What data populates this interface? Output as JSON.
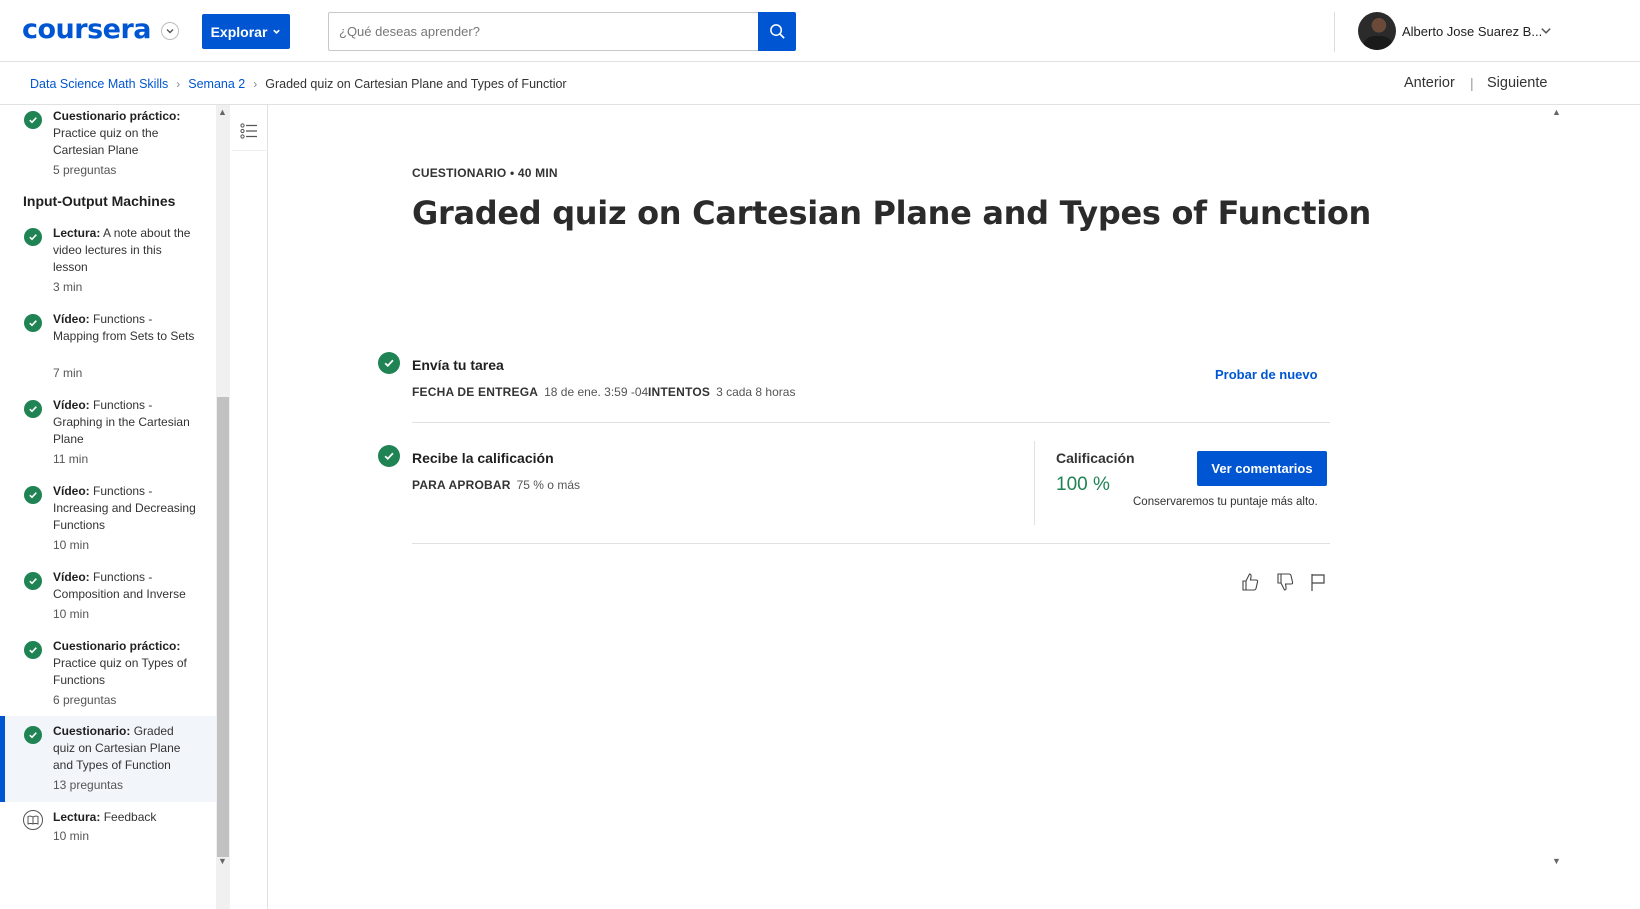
{
  "header": {
    "logo": "coursera",
    "explore_label": "Explorar",
    "search_placeholder": "¿Qué deseas aprender?",
    "user_name": "Alberto Jose Suarez B..."
  },
  "breadcrumb": {
    "items": [
      "Data Science Math Skills",
      "Semana 2"
    ],
    "current": "Graded quiz on Cartesian Plane and Types of Functior",
    "prev": "Anterior",
    "separator": "|",
    "next": "Siguiente"
  },
  "sidebar": {
    "section_title": "Input-Output Machines",
    "items": [
      {
        "type": "Cuestionario práctico:",
        "title": "Practice quiz on the Cartesian Plane",
        "meta": "5 preguntas",
        "completed": true
      },
      {
        "type": "Lectura:",
        "title": "A note about the video lectures in this lesson",
        "meta": "3 min",
        "completed": true
      },
      {
        "type": "Vídeo:",
        "title": "Functions - Mapping from Sets to Sets",
        "meta": "7 min",
        "completed": true
      },
      {
        "type": "Vídeo:",
        "title": "Functions - Graphing in the Cartesian Plane",
        "meta": "11 min",
        "completed": true
      },
      {
        "type": "Vídeo:",
        "title": "Functions - Increasing and Decreasing Functions",
        "meta": "10 min",
        "completed": true
      },
      {
        "type": "Vídeo:",
        "title": "Functions - Composition and Inverse",
        "meta": "10 min",
        "completed": true
      },
      {
        "type": "Cuestionario práctico:",
        "title": "Practice quiz on Types of Functions",
        "meta": "6 preguntas",
        "completed": true
      },
      {
        "type": "Cuestionario:",
        "title": "Graded quiz on Cartesian Plane and Types of Function",
        "meta": "13 preguntas",
        "completed": true,
        "active": true
      },
      {
        "type": "Lectura:",
        "title": "Feedback",
        "meta": "10 min",
        "completed": false
      }
    ]
  },
  "main": {
    "eyebrow": "CUESTIONARIO • 40 MIN",
    "title": "Graded quiz on Cartesian Plane and Types of Function",
    "submit": {
      "title": "Envía tu tarea",
      "due_label": "FECHA DE ENTREGA",
      "due_value": "18 de ene. 3:59 -04",
      "attempts_label": "INTENTOS",
      "attempts_value": "3 cada 8 horas",
      "retry": "Probar de nuevo"
    },
    "grade": {
      "title": "Recibe la calificación",
      "pass_label": "PARA APROBAR",
      "pass_value": "75 % o más",
      "label": "Calificación",
      "value": "100 %",
      "feedback_button": "Ver comentarios",
      "note": "Conservaremos tu puntaje más alto."
    }
  },
  "colors": {
    "brand": "#0056d2",
    "success": "#1f8354"
  }
}
